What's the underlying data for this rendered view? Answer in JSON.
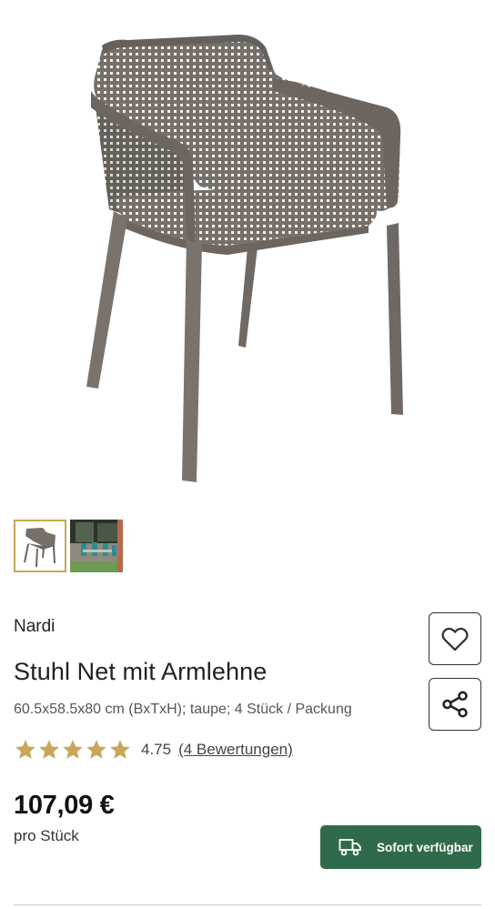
{
  "product": {
    "brand": "Nardi",
    "title": "Stuhl Net mit Armlehne",
    "description": "60.5x58.5x80 cm (BxTxH); taupe; 4 Stück / Packung",
    "rating": {
      "stars": 5,
      "value": "4.75",
      "reviews_link": "(4 Bewertungen)"
    },
    "price": "107,09 €",
    "unit": "pro Stück"
  },
  "gallery": {
    "thumbnails": [
      {
        "name": "chair-product-thumbnail",
        "active": true
      },
      {
        "name": "outdoor-scene-thumbnail",
        "active": false
      }
    ]
  },
  "actions": {
    "favorite_icon": "heart-icon",
    "share_icon": "share-icon",
    "availability_label": "Sofort verfügbar",
    "availability_icon": "truck-icon"
  },
  "colors": {
    "accent_gold": "#c8a75a",
    "button_green": "#2f6b4a",
    "chair_taupe": "#7a716b"
  }
}
